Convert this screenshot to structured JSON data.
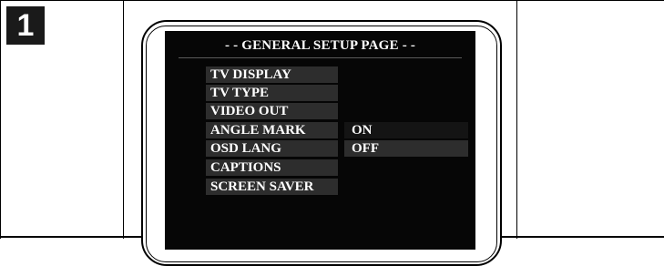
{
  "step": {
    "number": "1"
  },
  "menu": {
    "title": "- - GENERAL SETUP PAGE - -",
    "items": [
      {
        "label": "TV DISPLAY"
      },
      {
        "label": "TV TYPE"
      },
      {
        "label": "VIDEO OUT"
      },
      {
        "label": "ANGLE MARK"
      },
      {
        "label": "OSD LANG"
      },
      {
        "label": "CAPTIONS"
      },
      {
        "label": "SCREEN SAVER"
      }
    ],
    "options": [
      {
        "label": "ON",
        "state": "highlighted"
      },
      {
        "label": "OFF",
        "state": "normal"
      }
    ]
  },
  "colors": {
    "screen_background": "#060606",
    "menu_item_background": "#2d2d2d",
    "highlighted_option_background": "#141414",
    "text": "#ffffff"
  }
}
